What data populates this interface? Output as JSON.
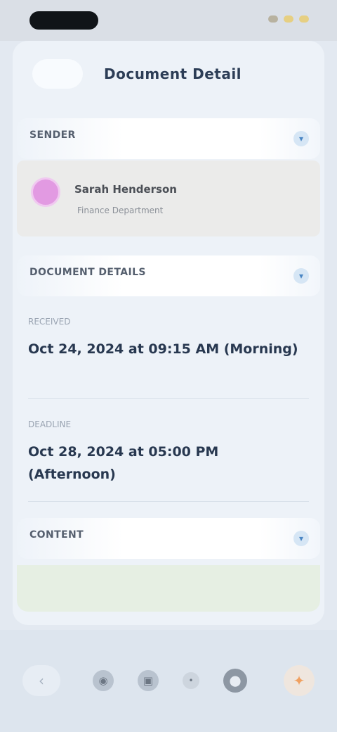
{
  "status_bar": {
    "time": ""
  },
  "header": {
    "back_label": "",
    "title": "Document Detail"
  },
  "sections": {
    "sender": {
      "label": "SENDER",
      "chevron": "▾"
    },
    "document_details": {
      "label": "DOCUMENT DETAILS",
      "chevron": "▾"
    },
    "content": {
      "label": "CONTENT",
      "chevron": "▾"
    }
  },
  "sender": {
    "name": "Sarah Henderson",
    "subtitle": "Finance Department"
  },
  "details": [
    {
      "label": "RECEIVED",
      "value": "Oct 24, 2024 at 09:15 AM (Morning)"
    },
    {
      "label": "DEADLINE",
      "value": "Oct 28, 2024 at 05:00 PM (Afternoon)"
    }
  ],
  "bottom_nav": {
    "left_icon": "‹",
    "icons": [
      "◉",
      "▣",
      "•",
      "⬤"
    ],
    "right_icon": "✦"
  }
}
